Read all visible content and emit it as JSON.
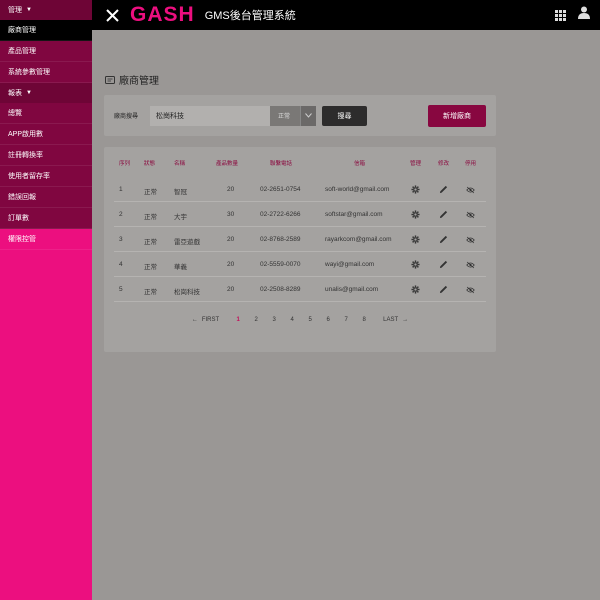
{
  "sidebar": {
    "group_manage": {
      "label": "管理",
      "caret": "▼"
    },
    "group_manage_items": [
      {
        "label": "廠商管理",
        "state": "active"
      },
      {
        "label": "產品管理",
        "state": "dark"
      },
      {
        "label": "系統參數管理",
        "state": "dark"
      }
    ],
    "group_report": {
      "label": "報表",
      "caret": "▼"
    },
    "group_report_items": [
      {
        "label": "總覽"
      },
      {
        "label": "APP啟用數"
      },
      {
        "label": "註冊轉換率"
      },
      {
        "label": "使用者留存率"
      },
      {
        "label": "錯誤回報"
      },
      {
        "label": "訂單數"
      }
    ],
    "perm_item": {
      "label": "權限控管"
    }
  },
  "topbar": {
    "logo": "GASH",
    "title": "GMS後台管理系統"
  },
  "page": {
    "title": "廠商管理"
  },
  "search": {
    "label": "廠商搜尋",
    "value": "松崗科技",
    "status_value": "正常",
    "search_button": "搜尋",
    "add_button": "新增廠商"
  },
  "table": {
    "headers": [
      "序列",
      "狀態",
      "名稱",
      "產品數量",
      "聯繫電話",
      "信箱",
      "管理",
      "修改",
      "停用"
    ],
    "rows": [
      {
        "seq": "1",
        "status": "正常",
        "name": "智冠",
        "count": "20",
        "phone": "02-2651-0754",
        "email": "soft-world@gmail.com"
      },
      {
        "seq": "2",
        "status": "正常",
        "name": "大宇",
        "count": "30",
        "phone": "02-2722-6266",
        "email": "softstar@gmail.com"
      },
      {
        "seq": "3",
        "status": "正常",
        "name": "雷亞遊戲",
        "count": "20",
        "phone": "02-8768-2589",
        "email": "rayarkcom@gmail.com"
      },
      {
        "seq": "4",
        "status": "正常",
        "name": "華義",
        "count": "20",
        "phone": "02-5559-0070",
        "email": "wayi@gmail.com"
      },
      {
        "seq": "5",
        "status": "正常",
        "name": "松崗科技",
        "count": "20",
        "phone": "02-2508-8289",
        "email": "unalis@gmail.com"
      }
    ]
  },
  "pager": {
    "first": "FIRST",
    "last": "LAST",
    "pages": [
      "1",
      "2",
      "3",
      "4",
      "5",
      "6",
      "7",
      "8"
    ],
    "current": "1"
  },
  "colors": {
    "brand": "#ec0f7f",
    "sidebar_dark": "#800640",
    "header": "#000000",
    "background": "#9a9795"
  },
  "icons": {
    "close": "close-icon",
    "apps": "apps-grid-icon",
    "user": "user-icon",
    "manage": "gear-icon",
    "edit": "pencil-icon",
    "disable": "eye-off-icon"
  }
}
